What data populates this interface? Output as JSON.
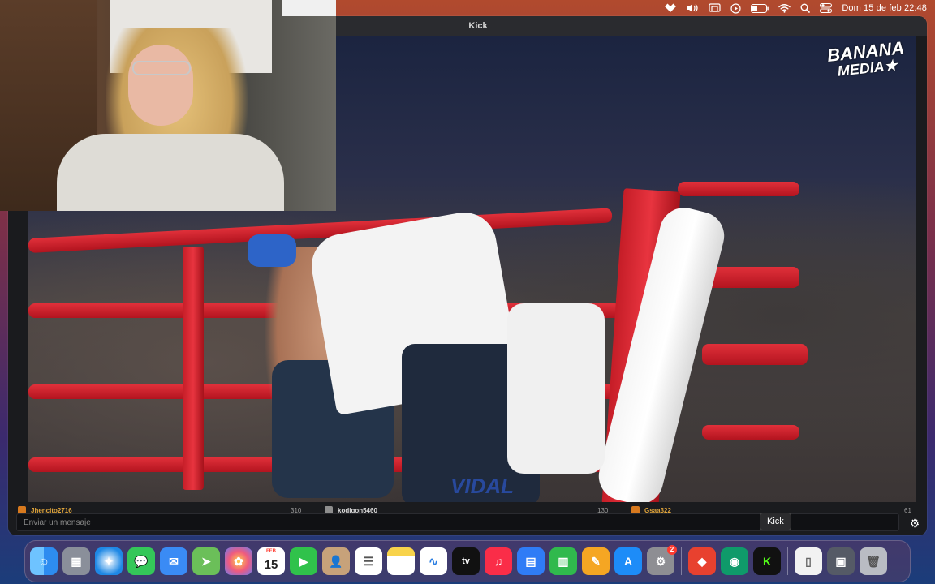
{
  "menubar": {
    "date_time": "Dom 15 de feb  22:48",
    "icons": [
      "tidal-icon",
      "volume-icon",
      "screen-mirror-icon",
      "play-icon",
      "battery-icon",
      "wifi-icon",
      "search-icon",
      "control-center-icon"
    ]
  },
  "window": {
    "title": "Kick"
  },
  "video": {
    "watermark_line1": "BANANA",
    "watermark_line2": "MEDIA★",
    "lower_text": "VIDAL"
  },
  "chat": {
    "entries": [
      {
        "user": "Jhencito2716",
        "count": "310"
      },
      {
        "user": "kodigon5460",
        "count": "130"
      },
      {
        "user": "Gsaa322",
        "count": "61"
      }
    ],
    "composer_placeholder": "Enviar un mensaje"
  },
  "tooltip": {
    "label": "Kick"
  },
  "dock": {
    "calendar_month": "FEB",
    "calendar_day": "15",
    "settings_badge": "2",
    "tv_label": "tv",
    "items": [
      {
        "name": "finder-icon",
        "color": "#2d8cf0"
      },
      {
        "name": "launchpad-icon",
        "color": "#8a8f9a"
      },
      {
        "name": "safari-icon",
        "color": "#1e88e5"
      },
      {
        "name": "messages-icon",
        "color": "#34c759"
      },
      {
        "name": "mail-icon",
        "color": "#3a8bf5"
      },
      {
        "name": "maps-icon",
        "color": "#6bbf59"
      },
      {
        "name": "photos-icon",
        "color": "#f3a63b"
      },
      {
        "name": "calendar-icon",
        "color": "#ffffff"
      },
      {
        "name": "facetime-icon",
        "color": "#30c24b"
      },
      {
        "name": "contacts-icon",
        "color": "#c7a27a"
      },
      {
        "name": "reminders-icon",
        "color": "#ffffff"
      },
      {
        "name": "notes-icon",
        "color": "#f8d34b"
      },
      {
        "name": "freeform-icon",
        "color": "#ffffff"
      },
      {
        "name": "apple-tv-icon",
        "color": "#111111"
      },
      {
        "name": "music-icon",
        "color": "#fa2d48"
      },
      {
        "name": "keynote-icon",
        "color": "#2f7cf6"
      },
      {
        "name": "numbers-icon",
        "color": "#30b94d"
      },
      {
        "name": "pages-icon",
        "color": "#f5a623"
      },
      {
        "name": "app-store-icon",
        "color": "#1d8cf8"
      },
      {
        "name": "system-settings-icon",
        "color": "#8e8e93"
      },
      {
        "name": "anydesk-icon",
        "color": "#e8412f"
      },
      {
        "name": "ai-app-icon",
        "color": "#0f9a6a"
      },
      {
        "name": "kick-icon",
        "color": "#111111"
      },
      {
        "name": "document-icon",
        "color": "#f2f2f2"
      },
      {
        "name": "downloads-stack-icon",
        "color": "#555a66"
      },
      {
        "name": "trash-icon",
        "color": "#b9bcc3"
      }
    ]
  }
}
